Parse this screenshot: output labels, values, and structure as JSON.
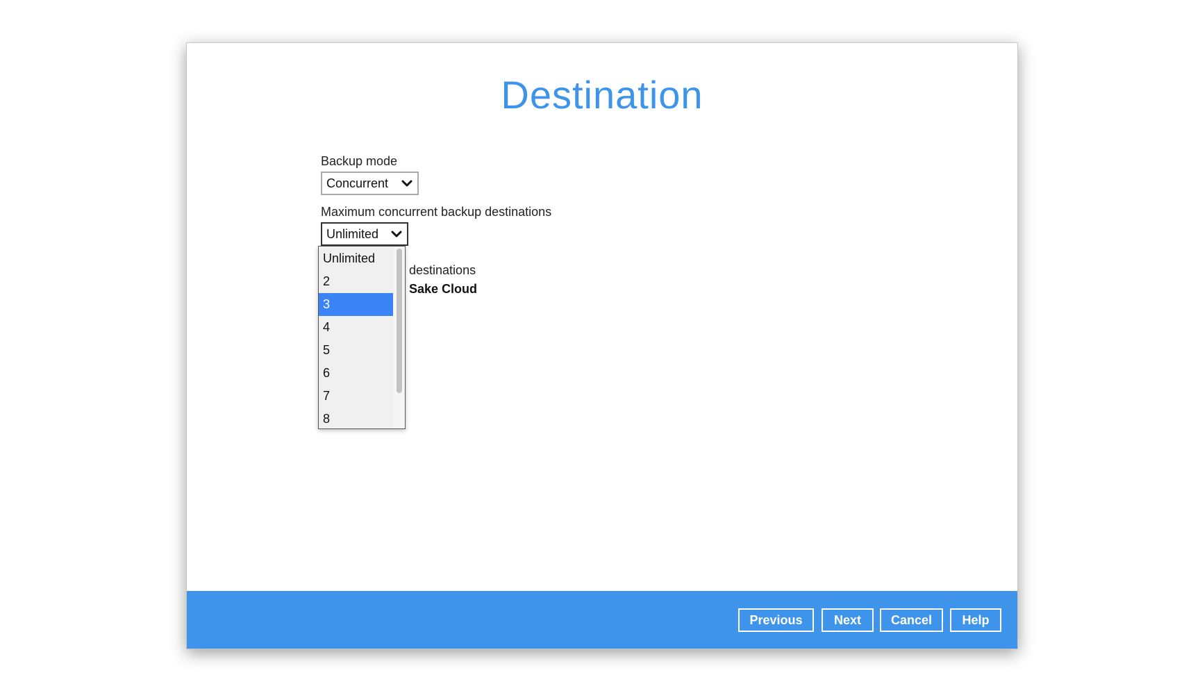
{
  "page": {
    "title": "Destination"
  },
  "backup_mode": {
    "label": "Backup mode",
    "value": "Concurrent"
  },
  "max_destinations": {
    "label": "Maximum concurrent backup destinations",
    "value": "Unlimited",
    "options": [
      "Unlimited",
      "2",
      "3",
      "4",
      "5",
      "6",
      "7",
      "8"
    ],
    "highlighted": "3"
  },
  "destinations": {
    "label_partial": "e destinations",
    "item_partial": "y Sake Cloud"
  },
  "footer": {
    "previous": "Previous",
    "next": "Next",
    "cancel": "Cancel",
    "help": "Help"
  },
  "colors": {
    "accent": "#3d94ea",
    "selection": "#3b84f5"
  },
  "icons": {
    "dropdown": "chevron-down-icon"
  }
}
